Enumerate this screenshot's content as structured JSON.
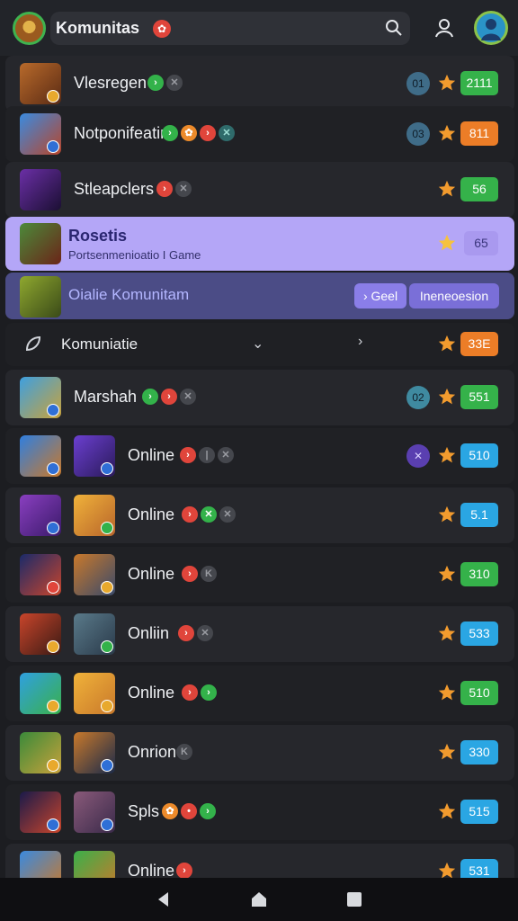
{
  "header": {
    "title": "Komunitas",
    "title_badge": "✿",
    "logo_icon": "community-logo",
    "search_icon": "search-icon",
    "user_icon": "user-icon",
    "avatar_color": "#2a93c7"
  },
  "rows": [
    {
      "name": "Vlesregen",
      "dots": [
        "green",
        "gray"
      ],
      "circle": "01",
      "score": "2111",
      "score_color": "green"
    },
    {
      "name": "Notponifeatir",
      "dots": [
        "green",
        "orange",
        "red",
        "teal"
      ],
      "circle": "03",
      "score": "811",
      "score_color": "orange"
    },
    {
      "name": "Stleapclers",
      "dots": [
        "red",
        "gray"
      ],
      "score": "56",
      "score_color": "green"
    }
  ],
  "highlight": {
    "name": "Rosetis",
    "subtitle": "Portsenmenioatio I Game",
    "score": "65"
  },
  "selected": {
    "name": "Oialie Komunitam",
    "chip1": "› Geel",
    "chip2": "Ineneoesion"
  },
  "section": {
    "label": "Komuniatie",
    "score": "33E"
  },
  "marshal": {
    "name": "Marshah",
    "circle": "02",
    "score": "551"
  },
  "online_rows": [
    {
      "name": "Online",
      "dots": [
        "red",
        "gray",
        "gray"
      ],
      "circle": "✕",
      "score": "510",
      "score_color": "blue"
    },
    {
      "name": "Online",
      "dots": [
        "red",
        "green",
        "gray"
      ],
      "score": "5.1",
      "score_color": "blue"
    },
    {
      "name": "Online",
      "dots": [
        "red",
        "gray"
      ],
      "score": "310",
      "score_color": "green"
    },
    {
      "name": "Onliin",
      "dots": [
        "red",
        "gray"
      ],
      "score": "533",
      "score_color": "blue"
    },
    {
      "name": "Online",
      "dots": [
        "red",
        "green"
      ],
      "score": "510",
      "score_color": "green"
    },
    {
      "name": "Onrion",
      "dots": [
        "gray"
      ],
      "score": "330",
      "score_color": "blue"
    },
    {
      "name": "Spls",
      "dots": [
        "orange",
        "red",
        "green"
      ],
      "score": "515",
      "score_color": "blue"
    },
    {
      "name": "Online",
      "dots": [
        "red"
      ],
      "score": "531",
      "score_color": "blue"
    }
  ],
  "nav": [
    "back-icon",
    "home-icon",
    "recents-icon"
  ]
}
